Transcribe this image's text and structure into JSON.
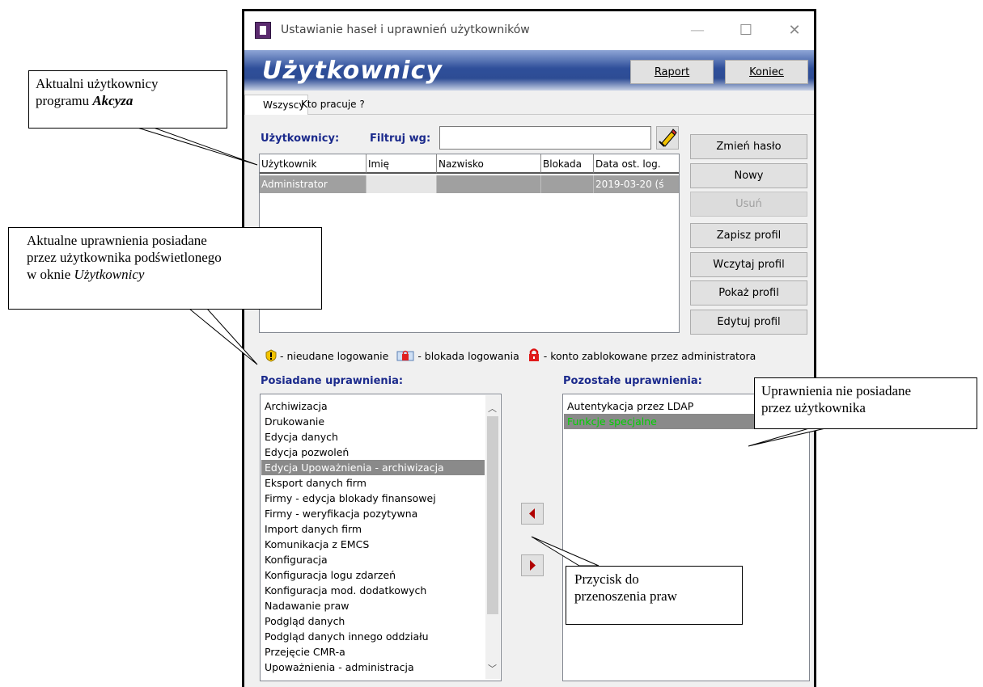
{
  "window": {
    "title": "Ustawianie haseł i uprawnień użytkowników",
    "banner_title": "Użytkownicy",
    "report_button": "Raport",
    "exit_button": "Koniec",
    "colors": {
      "banner": "#2f4f9a",
      "label_blue": "#1b2a8c",
      "special_function": "#00d000"
    }
  },
  "tabs": [
    "Wszyscy",
    "Kto pracuje ?"
  ],
  "users_panel": {
    "label": "Użytkownicy:",
    "filter_label": "Filtruj wg:",
    "filter_value": "",
    "columns": [
      "Użytkownik",
      "Imię",
      "Nazwisko",
      "Blokada",
      "Data ost. log."
    ],
    "rows": [
      {
        "user": "Administrator",
        "first": "",
        "last": "",
        "lock": "",
        "last_login": "2019-03-20 (ś"
      }
    ]
  },
  "side_buttons": [
    "Zmień hasło",
    "Nowy",
    "Usuń",
    "Zapisz profil",
    "Wczytaj profil",
    "Pokaż profil",
    "Edytuj profil"
  ],
  "legend": {
    "failed": "- nieudane logowanie",
    "blocked": "- blokada logowania",
    "locked": "- konto zablokowane przez administratora"
  },
  "owned_permissions": {
    "label": "Posiadane uprawnienia:",
    "selected": "Edycja Upoważnienia - archiwizacja",
    "items": [
      "Archiwizacja",
      "Drukowanie",
      "Edycja danych",
      "Edycja pozwoleń",
      "Edycja Upoważnienia - archiwizacja",
      "Eksport danych firm",
      "Firmy - edycja blokady finansowej",
      "Firmy - weryfikacja pozytywna",
      "Import danych firm",
      "Komunikacja z EMCS",
      "Konfiguracja",
      "Konfiguracja logu zdarzeń",
      "Konfiguracja mod. dodatkowych",
      "Nadawanie praw",
      "Podgląd danych",
      "Podgląd danych innego oddziału",
      "Przejęcie CMR-a",
      "Upoważnienia - administracja"
    ]
  },
  "other_permissions": {
    "label": "Pozostałe uprawnienia:",
    "items": [
      "Autentykacja przez LDAP",
      "Funkcje specjalne"
    ]
  },
  "callouts": {
    "users": {
      "line1": "Aktualni użytkownicy",
      "line2_prefix": "programu ",
      "line2_em": "Akcyza"
    },
    "owned": {
      "line1": "Aktualne uprawnienia posiadane",
      "line2": "przez użytkownika podświetlonego",
      "line3_prefix": "w oknie ",
      "line3_em": "Użytkownicy"
    },
    "not_owned": {
      "line1": "Uprawnienia nie posiadane",
      "line2": "przez użytkownika"
    },
    "transfer": {
      "line1": "Przycisk do",
      "line2": "przenoszenia praw"
    }
  }
}
